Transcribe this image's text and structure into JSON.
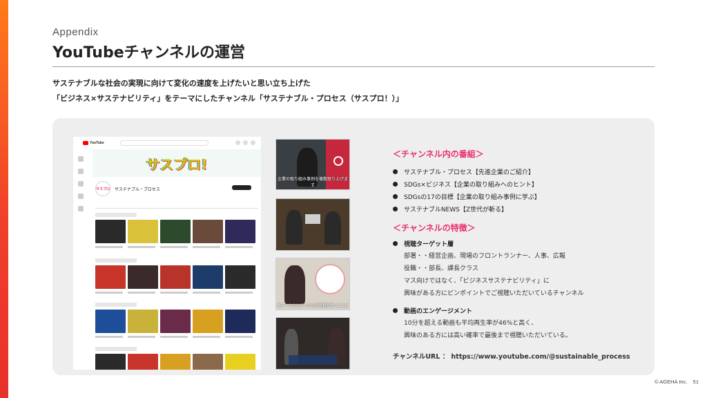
{
  "section_label": "Appendix",
  "title": "YouTubeチャンネルの運営",
  "intro": {
    "line1": "サステナブルな社会の実現に向けて変化の速度を上げたいと思い立ち上げた",
    "line2": "「ビジネス×サステナビリティ」をテーマにしたチャンネル「サステナブル・プロセス（サスプロ！）」"
  },
  "screenshot": {
    "site_logo": "YouTube",
    "banner_logo": "サスプロ!",
    "channel_name": "サステナブル・プロセス",
    "avatar_text": "サスプロ"
  },
  "stills": {
    "caption1": "企業の取り組み事例を複数取り上げます",
    "caption3": "ステークホルダーからの信頼を失うことに"
  },
  "programs": {
    "heading": "＜チャンネル内の番組＞",
    "items": [
      "サステナブル・プロセス【先進企業のご紹介】",
      "SDGs×ビジネス【企業の取り組みへのヒント】",
      "SDGsの17の目標【企業の取り組み事例に学ぶ】",
      "サステナブルNEWS【Z世代が斬る】"
    ]
  },
  "features": {
    "heading": "＜チャンネルの特徴＞",
    "target": {
      "label": "視聴ターゲット層",
      "lines": [
        "部署・・経営企画、現場のフロントランナー、人事、広報",
        "役職・・部長、課長クラス",
        "マス向けではなく、「ビジネスサステナビリティ」に",
        "興味がある方にピンポイントでご視聴いただいているチャンネル"
      ]
    },
    "engagement": {
      "label": "動画のエンゲージメント",
      "lines": [
        "10分を超える動画も平均再生率が46%と高く、",
        "興味のある方には高い確率で最後まで視聴いただいている。"
      ]
    }
  },
  "channel_url": "チャンネルURL ： https://www.youtube.com/@sustainable_process",
  "footer": {
    "copyright": "© AGEHA Inc.",
    "page_number": "51"
  },
  "colors": {
    "accent": "#e8306e",
    "strip_top": "#ff7a1a",
    "strip_bottom": "#e8302a"
  }
}
